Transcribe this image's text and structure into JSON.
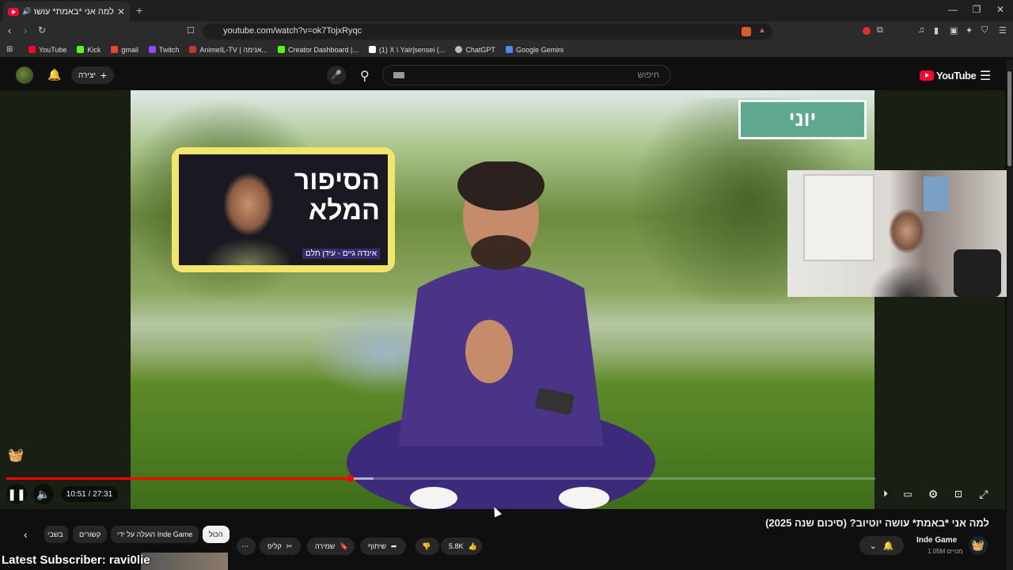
{
  "browser": {
    "tab_title": "למה אני *באמת* עושה יוטיוב?",
    "url": "youtube.com/watch?v=ok7TojxRyqc",
    "bookmarks": [
      {
        "label": "YouTube",
        "color": "#ff0033"
      },
      {
        "label": "Kick",
        "color": "#53fc18"
      },
      {
        "label": "gmail",
        "color": "#ea4335"
      },
      {
        "label": "Twitch",
        "color": "#9146ff"
      },
      {
        "label": "AnimeIL-TV | אנימה...",
        "color": "#c0392b"
      },
      {
        "label": "Creator Dashboard |...",
        "color": "#53fc18"
      },
      {
        "label": "(1) X \\ Yair|sensei (...",
        "color": "#ffffff"
      },
      {
        "label": "ChatGPT",
        "color": "#bbbbbb"
      },
      {
        "label": "Google Gemini",
        "color": "#4a8af4"
      }
    ]
  },
  "youtube": {
    "search_placeholder": "חיפוש",
    "create_label": "יצירה",
    "logo_text": "YouTube"
  },
  "video": {
    "thumb_title": "הסיפור המלא",
    "thumb_sub": "אינדה גיים - עידן תלם",
    "sign_text": "יוני",
    "time": "10:51 / 27:31",
    "progress_fraction": 0.395,
    "title": "למה אני *באמת* עושה יוטיוב? (סיכום שנה 2025)"
  },
  "channel": {
    "name": "Inde Game",
    "subs": "1.05M מנויים"
  },
  "actions": {
    "likes": "5.8K",
    "share": "שיתוף",
    "save": "שמירה",
    "clip": "קליפ"
  },
  "chips": [
    "הכול",
    "הועלה על ידי Inde Game",
    "קשורים",
    "בשבי"
  ],
  "overlay": {
    "latest": "Latest Subscriber: ravi0lie"
  }
}
